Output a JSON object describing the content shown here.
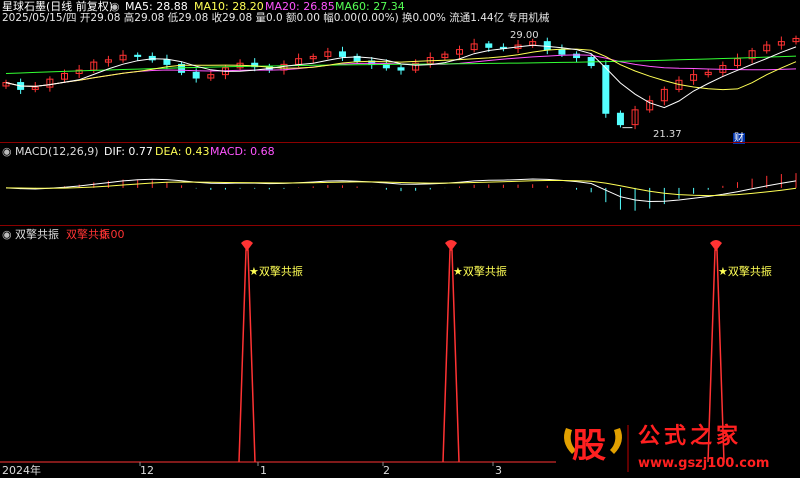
{
  "header": {
    "title": "星球石墨(日线 前复权)",
    "info": "2025/05/15/四 开29.08 高29.08 低29.08 收29.08 量0.0 额0.00 幅0.00(0.00%) 换0.00% 流通1.44亿 专用机械",
    "ma5": "MA5: 28.88",
    "ma10": "MA10: 28.20",
    "ma20": "MA20: 26.85",
    "ma60": "MA60: 27.34"
  },
  "price_annotations": {
    "high": "29.00",
    "low": "21.37",
    "cai": "财"
  },
  "macd_panel": {
    "label": "MACD(12,26,9)",
    "dif": "DIF: 0.77",
    "dea": "DEA: 0.43",
    "macd": "MACD: 0.68"
  },
  "signal_panel": {
    "label": "双擎共振",
    "value_name": "双擎共振",
    "value": "0.00",
    "marker_label": "★双擎共振"
  },
  "xaxis": {
    "year": "2024年",
    "labels": [
      "12",
      "1",
      "2",
      "3"
    ]
  },
  "watermark": {
    "glyph": "股",
    "brand": "公式之家",
    "url": "www.gszj100.com"
  },
  "colors": {
    "up": "#ff3333",
    "down": "#54ffff",
    "ma5": "#ffffff",
    "ma10": "#ffff55",
    "ma20": "#ff55ff",
    "ma60": "#33ff33",
    "signal": "#ff3333",
    "separator": "#8b0000"
  },
  "chart_data": [
    {
      "type": "candlestick",
      "title": "星球石墨(日线 前复权)",
      "x_labels": [
        "2024年",
        "12",
        "1",
        "2",
        "3"
      ],
      "annotations": [
        {
          "text": "29.00",
          "kind": "period-high"
        },
        {
          "text": "21.37",
          "kind": "period-low"
        }
      ],
      "close_approx": [
        25.2,
        24.6,
        24.8,
        25.5,
        26.0,
        26.3,
        27.0,
        27.2,
        27.6,
        27.5,
        27.2,
        26.8,
        26.1,
        25.6,
        25.9,
        26.5,
        26.9,
        26.6,
        26.3,
        26.8,
        27.3,
        27.5,
        27.9,
        27.5,
        27.1,
        26.8,
        26.5,
        26.3,
        26.9,
        27.4,
        27.7,
        28.1,
        28.6,
        28.3,
        28.2,
        28.5,
        28.8,
        28.1,
        27.7,
        27.4,
        26.7,
        22.5,
        21.5,
        22.8,
        23.6,
        24.6,
        25.4,
        25.9,
        26.1,
        26.7,
        27.3,
        28.0,
        28.5,
        28.8,
        29.08
      ],
      "ma_lines": [
        {
          "name": "MA5",
          "last": 28.88
        },
        {
          "name": "MA10",
          "last": 28.2
        },
        {
          "name": "MA20",
          "last": 26.85
        },
        {
          "name": "MA60",
          "last": 27.34
        }
      ]
    },
    {
      "type": "line",
      "title": "MACD(12,26,9)",
      "series": [
        {
          "name": "DIF",
          "last": 0.77
        },
        {
          "name": "DEA",
          "last": 0.43
        },
        {
          "name": "MACD",
          "last": 0.68
        }
      ]
    },
    {
      "type": "line",
      "title": "双擎共振",
      "series": [
        {
          "name": "双擎共振",
          "last": 0.0
        }
      ],
      "signal_spikes": [
        {
          "x_index": 18,
          "value": 1,
          "label": "★双擎共振"
        },
        {
          "x_index": 34,
          "value": 1,
          "label": "★双擎共振"
        },
        {
          "x_index": 55,
          "value": 1,
          "label": "★双擎共振"
        }
      ]
    }
  ]
}
